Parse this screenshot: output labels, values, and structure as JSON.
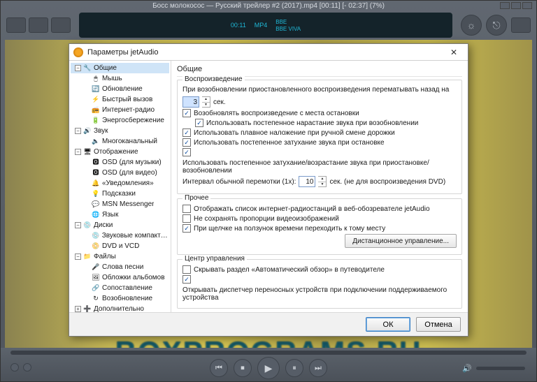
{
  "player": {
    "title": "Босс молокосос — Русский трейлер #2 (2017).mp4 [00:11] [- 02:37] (7%)",
    "eq": {
      "ltime": "00:11",
      "format": "MP4",
      "bbe_label": "BBE",
      "viva_label": "BBE VIVA"
    },
    "watermark": "BOXPROGRAMS.RU"
  },
  "dialog": {
    "title": "Параметры jetAudio",
    "header": "Общие",
    "tree": {
      "general": "Общие",
      "mouse": "Мышь",
      "update": "Обновление",
      "quickcall": "Быстрый вызов",
      "iradio": "Интернет-радио",
      "power": "Энергосбережение",
      "sound": "Звук",
      "multichannel": "Многоканальный",
      "display": "Отображение",
      "osd_music": "OSD (для музыки)",
      "osd_video": "OSD (для видео)",
      "notifications": "«Уведомления»",
      "hints": "Подсказки",
      "msn": "MSN Messenger",
      "lang": "Язык",
      "discs": "Диски",
      "audio_cd": "Звуковые компакт-ди",
      "dvd_vcd": "DVD и VCD",
      "files": "Файлы",
      "lyrics": "Слова песни",
      "covers": "Обложки альбомов",
      "assoc": "Сопоставление",
      "playback2": "Возобновление",
      "extra": "Дополнительно"
    },
    "groups": {
      "playback": {
        "title": "Воспроизведение",
        "resume_rewind_pre": "При возобновлении приостановленного воспроизведения перематывать назад на",
        "resume_rewind_value": "3",
        "resume_rewind_unit": "сек.",
        "cb_resume": "Возобновлять воспроизведение с места остановки",
        "cb_fadein": "Использовать постепенное нарастание звука при возобновлении",
        "cb_crossfade": "Использовать плавное наложение при ручной смене дорожки",
        "cb_fadeout_stop": "Использовать постепенное затухание звука при остановке",
        "cb_fade_pause": "Использовать постепенное затухание/возрастание звука при приостановке/возобновлении",
        "seek_interval_label": "Интервал обычной перемотки (1x):",
        "seek_interval_value": "10",
        "seek_interval_suffix": "сек. (не для воспроизведения DVD)"
      },
      "other": {
        "title": "Прочее",
        "cb_radio_browser": "Отображать список интернет-радиостанций в веб-обозревателе jetAudio",
        "cb_keep_aspect": "Не сохранять пропорции видеоизображений",
        "cb_seek_click": "При щелчке на ползунок времени переходить к тому месту",
        "remote_btn": "Дистанционное управление..."
      },
      "cc": {
        "title": "Центр управления",
        "cb_hide_auto": "Скрывать раздел «Автоматический обзор» в путеводителе",
        "cb_open_pmd": "Открывать диспетчер переносных устройств при подключении поддерживаемого устройства"
      }
    },
    "buttons": {
      "ok": "ОК",
      "cancel": "Отмена"
    }
  }
}
